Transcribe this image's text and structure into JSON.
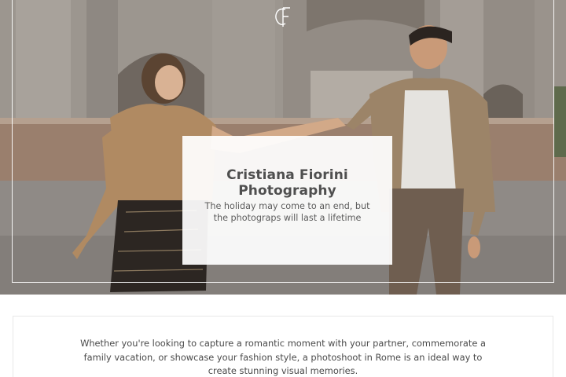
{
  "hero": {
    "logo_icon": "cf-monogram-logo",
    "title": "Cristiana Fiorini Photography",
    "tagline": "The holiday may come to an end, but the photograps will last a lifetime",
    "card_color": "#ffffff",
    "frame_color": "#ffffff"
  },
  "intro": {
    "text": "Whether you're looking to capture a romantic moment with your partner, commemorate a family vacation, or showcase your fashion style, a photoshoot in Rome is an ideal way to create stunning visual memories."
  }
}
